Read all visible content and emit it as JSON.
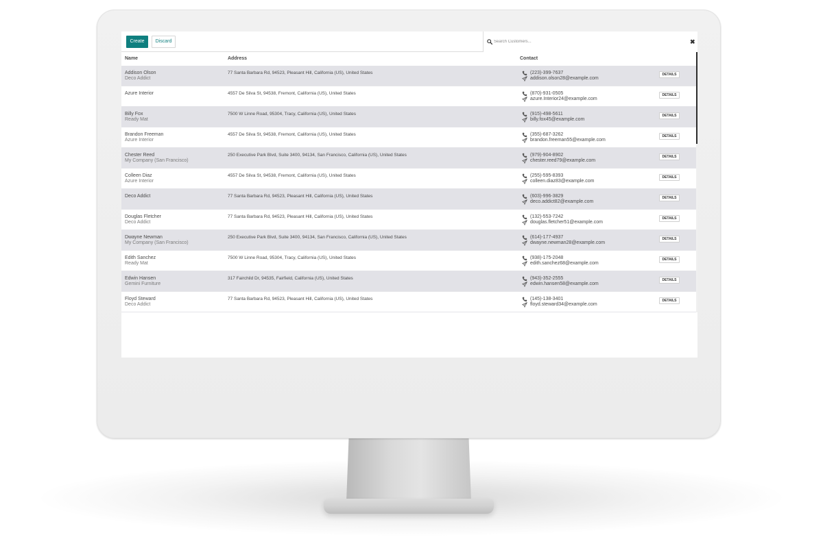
{
  "toolbar": {
    "create_label": "Create",
    "discard_label": "Discard"
  },
  "search": {
    "placeholder": "Search Customers...",
    "clear_glyph": "✖"
  },
  "table": {
    "columns": {
      "name": "Name",
      "address": "Address",
      "contact": "Contact"
    },
    "details_label": "DETAILS",
    "rows": [
      {
        "name": "Addison Olson",
        "company": "Deco Addict",
        "address": "77 Santa Barbara Rd, 94523, Pleasant Hill, California (US), United States",
        "phone": "(223)-399-7637",
        "email": "addison.olson28@example.com"
      },
      {
        "name": "Azure Interior",
        "company": "",
        "address": "4557 De Silva St, 94538, Fremont, California (US), United States",
        "phone": "(870)-931-0505",
        "email": "azure.Interior24@example.com"
      },
      {
        "name": "Billy Fox",
        "company": "Ready Mat",
        "address": "7500 W Linne Road, 95304, Tracy, California (US), United States",
        "phone": "(915)-498-5611",
        "email": "billy.fox45@example.com"
      },
      {
        "name": "Brandon Freeman",
        "company": "Azure Interior",
        "address": "4557 De Silva St, 94538, Fremont, California (US), United States",
        "phone": "(355)-687-3262",
        "email": "brandon.freeman55@example.com"
      },
      {
        "name": "Chester Reed",
        "company": "My Company (San Francisco)",
        "address": "250 Executive Park Blvd, Suite 3400, 94134, San Francisco, California (US), United States",
        "phone": "(979)-904-8902",
        "email": "chester.reed79@example.com"
      },
      {
        "name": "Colleen Diaz",
        "company": "Azure Interior",
        "address": "4557 De Silva St, 94538, Fremont, California (US), United States",
        "phone": "(255)-595-8393",
        "email": "colleen.diaz83@example.com"
      },
      {
        "name": "Deco Addict",
        "company": "",
        "address": "77 Santa Barbara Rd, 94523, Pleasant Hill, California (US), United States",
        "phone": "(603)-996-3829",
        "email": "deco.addict82@example.com"
      },
      {
        "name": "Douglas Fletcher",
        "company": "Deco Addict",
        "address": "77 Santa Barbara Rd, 94523, Pleasant Hill, California (US), United States",
        "phone": "(132)-553-7242",
        "email": "douglas.fletcher51@example.com"
      },
      {
        "name": "Dwayne Newman",
        "company": "My Company (San Francisco)",
        "address": "250 Executive Park Blvd, Suite 3400, 94134, San Francisco, California (US), United States",
        "phone": "(614)-177-4937",
        "email": "dwayne.newman28@example.com"
      },
      {
        "name": "Edith Sanchez",
        "company": "Ready Mat",
        "address": "7500 W Linne Road, 95304, Tracy, California (US), United States",
        "phone": "(938)-175-2048",
        "email": "edith.sanchez68@example.com"
      },
      {
        "name": "Edwin Hansen",
        "company": "Gemini Furniture",
        "address": "317 Fairchild Dr, 94535, Fairfield, California (US), United States",
        "phone": "(943)-352-2555",
        "email": "edwin.hansen58@example.com"
      },
      {
        "name": "Floyd Steward",
        "company": "Deco Addict",
        "address": "77 Santa Barbara Rd, 94523, Pleasant Hill, California (US), United States",
        "phone": "(145)-138-3401",
        "email": "floyd.steward34@example.com"
      }
    ]
  },
  "colors": {
    "accent": "#0f7f7f",
    "row_alt": "#e2e2e7",
    "text": "#4a4a4a",
    "muted": "#7a7a7a"
  },
  "icons": {
    "search": "search-icon",
    "clear": "close-icon",
    "phone": "phone-icon",
    "email": "paper-plane-icon"
  }
}
